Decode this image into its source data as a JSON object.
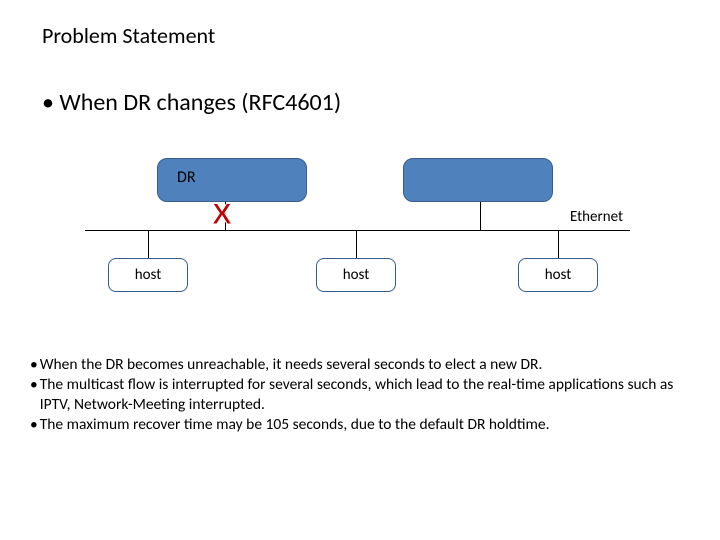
{
  "title": "Problem Statement",
  "main_bullet": "•  When DR changes (RFC4601)",
  "diagram": {
    "dr_label": "DR",
    "ethernet_label": "Ethernet",
    "x_mark": "X",
    "host_label": "host"
  },
  "bullets": [
    "When the DR becomes unreachable, it needs several seconds to elect a new DR.",
    "The multicast flow is interrupted for several seconds, which lead to the real-time applications such as IPTV, Network-Meeting  interrupted.",
    "The maximum recover time may be 105 seconds, due to the default DR holdtime."
  ]
}
